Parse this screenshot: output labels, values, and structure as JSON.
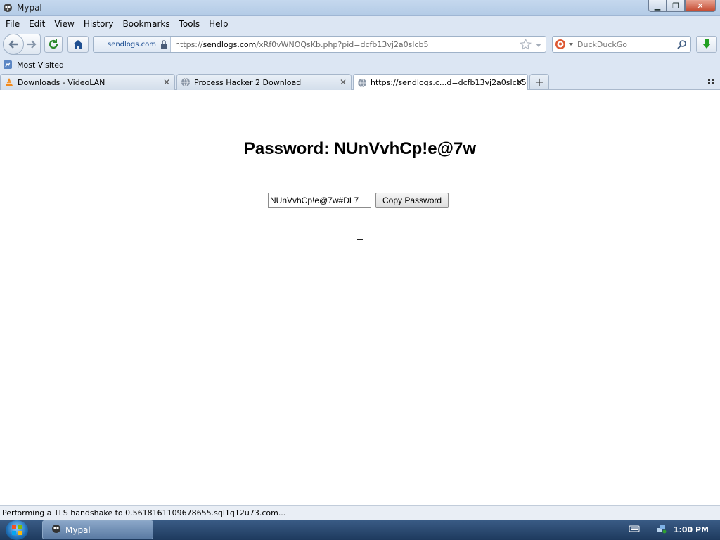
{
  "window": {
    "title": "Mypal",
    "controls": {
      "minimize": "▁",
      "maximize": "❐",
      "close": "✕"
    }
  },
  "menu": {
    "items": [
      {
        "label": "File"
      },
      {
        "label": "Edit"
      },
      {
        "label": "View"
      },
      {
        "label": "History"
      },
      {
        "label": "Bookmarks"
      },
      {
        "label": "Tools"
      },
      {
        "label": "Help"
      }
    ]
  },
  "navbar": {
    "site_identity": "sendlogs.com",
    "url_scheme": "https://",
    "url_domain": "sendlogs.com",
    "url_path": "/xRf0vWNOQsKb.php?pid=dcfb13vj2a0slcb5",
    "search_engine": "DuckDuckGo"
  },
  "bookmarks": {
    "items": [
      {
        "label": "Most Visited"
      }
    ]
  },
  "tabs": [
    {
      "label": "Downloads - VideoLAN",
      "icon": "vlc-cone-icon",
      "active": false
    },
    {
      "label": "Process Hacker 2 Download",
      "icon": "globe-icon",
      "active": false
    },
    {
      "label": "https://sendlogs.c...d=dcfb13vj2a0slcb5",
      "icon": "globe-icon",
      "active": true
    }
  ],
  "page": {
    "heading": "Password: NUnVvhCp!e@7w",
    "password_value": "NUnVvhCp!e@7w#DL7",
    "copy_button": "Copy Password"
  },
  "status": {
    "text": "Performing a TLS handshake to 0.5618161109678655.sql1q12u73.com..."
  },
  "taskbar": {
    "task_label": "Mypal",
    "clock": "1:00 PM"
  },
  "colors": {
    "chrome": "#dce6f3",
    "titlebar": "#b3cbe6",
    "taskbar": "#1e3a5e"
  }
}
